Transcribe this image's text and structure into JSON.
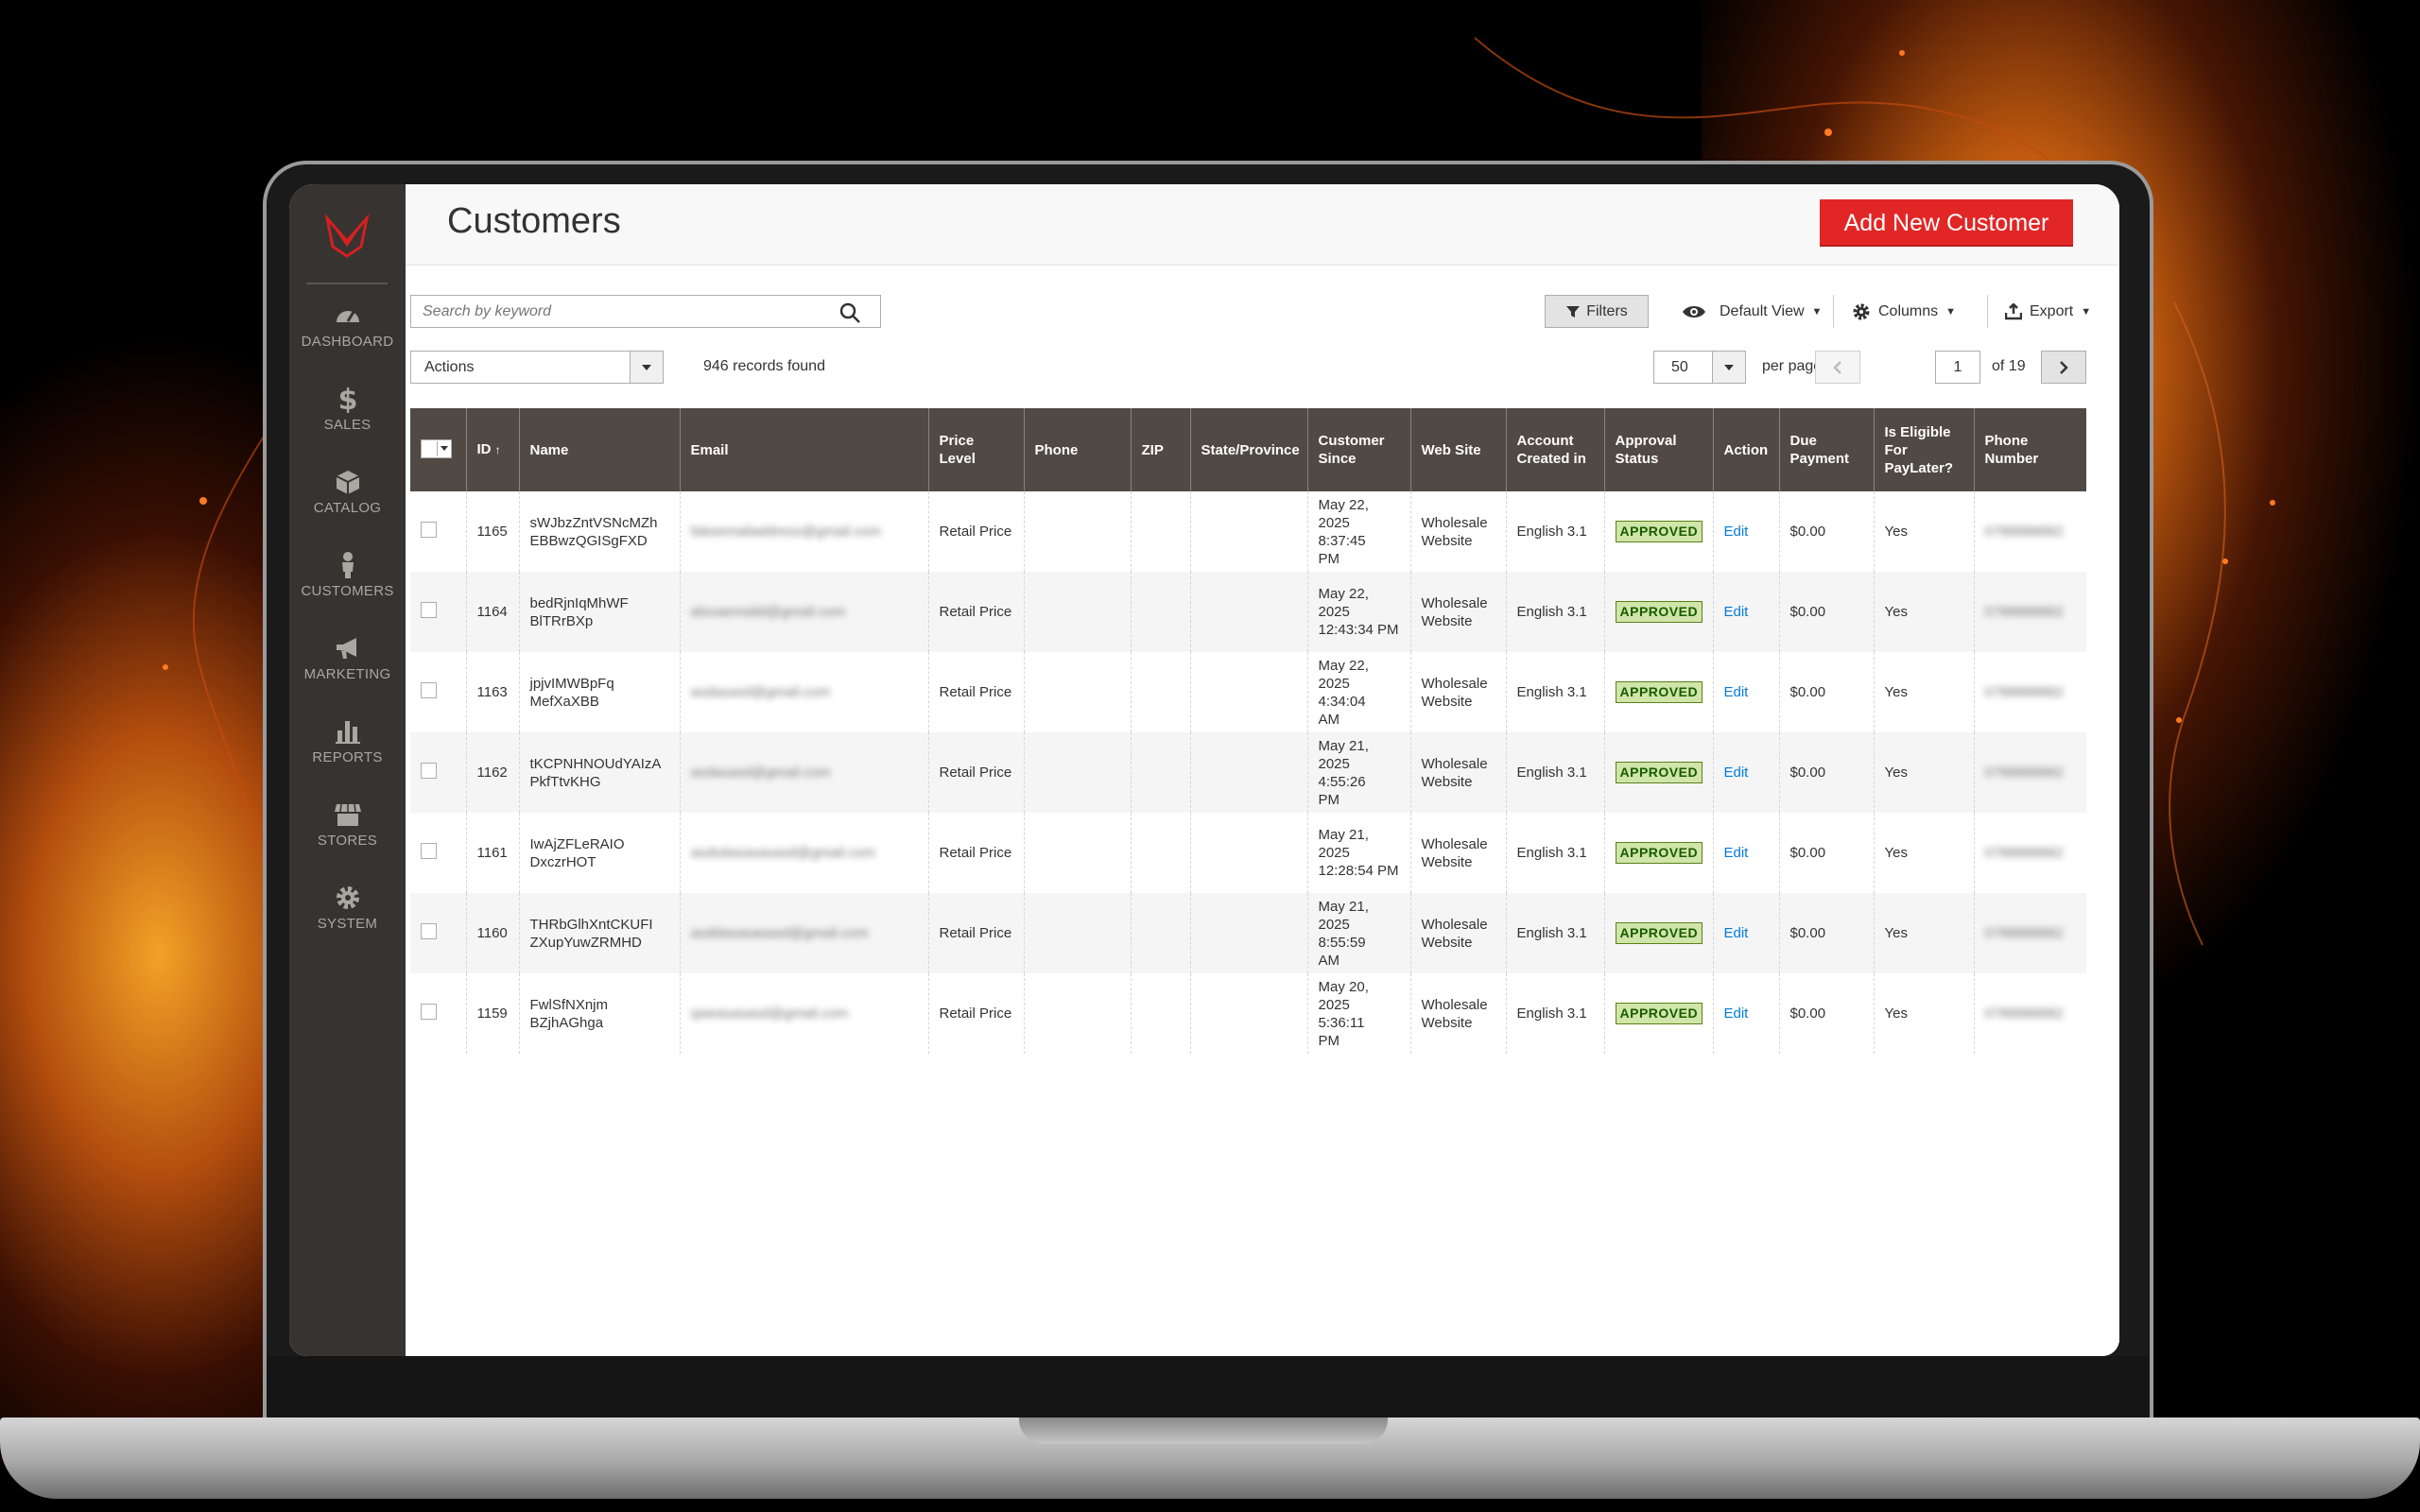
{
  "app": {
    "title": "Customers",
    "accent_color": "#e22626",
    "sidebar_bg": "#373330"
  },
  "sidebar": {
    "items": [
      {
        "label": "DASHBOARD",
        "icon": "dashboard-icon"
      },
      {
        "label": "SALES",
        "icon": "dollar-icon"
      },
      {
        "label": "CATALOG",
        "icon": "box-icon"
      },
      {
        "label": "CUSTOMERS",
        "icon": "person-icon"
      },
      {
        "label": "MARKETING",
        "icon": "megaphone-icon"
      },
      {
        "label": "REPORTS",
        "icon": "bar-chart-icon"
      },
      {
        "label": "STORES",
        "icon": "storefront-icon"
      },
      {
        "label": "SYSTEM",
        "icon": "gear-icon"
      }
    ]
  },
  "header": {
    "title": "Customers",
    "add_button": "Add New Customer"
  },
  "toolbar": {
    "search_placeholder": "Search by keyword",
    "filters": "Filters",
    "default_view": "Default View",
    "columns": "Columns",
    "export": "Export",
    "actions": "Actions",
    "records_found": "946 records found",
    "per_page_value": "50",
    "per_page_label": "per page",
    "current_page": "1",
    "total_pages": "of 19"
  },
  "grid": {
    "columns": [
      "ID",
      "Name",
      "Email",
      "Price Level",
      "Phone",
      "ZIP",
      "State/Province",
      "Customer Since",
      "Web Site",
      "Account Created in",
      "Approval Status",
      "Action",
      "Due Payment",
      "Is Eligible For PayLater?",
      "Phone Number"
    ],
    "sort_indicator": "↑",
    "rows": [
      {
        "id": "1165",
        "name1": "sWJbzZntVSNcMZh",
        "name2": "EBBwzQGISgFXD",
        "email": "fakeemailaddress@gmail.com",
        "price_level": "Retail Price",
        "since1": "May 22,",
        "since2": "2025 8:37:45",
        "since3": "PM",
        "website1": "Wholesale",
        "website2": "Website",
        "created": "English 3.1",
        "status": "APPROVED",
        "action": "Edit",
        "due": "$0.00",
        "eligible": "Yes",
        "phone": "0788888882"
      },
      {
        "id": "1164",
        "name1": "bedRjnIqMhWF",
        "name2": "BlTRrBXp",
        "email": "alsoaemaild@gmail.com",
        "price_level": "Retail Price",
        "since1": "May 22,",
        "since2": "2025",
        "since3": "12:43:34 PM",
        "website1": "Wholesale",
        "website2": "Website",
        "created": "English 3.1",
        "status": "APPROVED",
        "action": "Edit",
        "due": "$0.00",
        "eligible": "Yes",
        "phone": "0788888882"
      },
      {
        "id": "1163",
        "name1": "jpjvIMWBpFq",
        "name2": "MefXaXBB",
        "email": "asdasasd@gmail.com",
        "price_level": "Retail Price",
        "since1": "May 22,",
        "since2": "2025 4:34:04",
        "since3": "AM",
        "website1": "Wholesale",
        "website2": "Website",
        "created": "English 3.1",
        "status": "APPROVED",
        "action": "Edit",
        "due": "$0.00",
        "eligible": "Yes",
        "phone": "0788888882"
      },
      {
        "id": "1162",
        "name1": "tKCPNHNOUdYAIzA",
        "name2": "PkfTtvKHG",
        "email": "asdasasd@gmail.com",
        "price_level": "Retail Price",
        "since1": "May 21,",
        "since2": "2025 4:55:26",
        "since3": "PM",
        "website1": "Wholesale",
        "website2": "Website",
        "created": "English 3.1",
        "status": "APPROVED",
        "action": "Edit",
        "due": "$0.00",
        "eligible": "Yes",
        "phone": "0788888882"
      },
      {
        "id": "1161",
        "name1": "IwAjZFLeRAIO",
        "name2": "DxczrHOT",
        "email": "asdsdasasasasd@gmail.com",
        "price_level": "Retail Price",
        "since1": "May 21,",
        "since2": "2025",
        "since3": "12:28:54 PM",
        "website1": "Wholesale",
        "website2": "Website",
        "created": "English 3.1",
        "status": "APPROVED",
        "action": "Edit",
        "due": "$0.00",
        "eligible": "Yes",
        "phone": "0788888882"
      },
      {
        "id": "1160",
        "name1": "THRbGlhXntCKUFI",
        "name2": "ZXupYuwZRMHD",
        "email": "asddasasasasd@gmail.com",
        "price_level": "Retail Price",
        "since1": "May 21,",
        "since2": "2025 8:55:59",
        "since3": "AM",
        "website1": "Wholesale",
        "website2": "Website",
        "created": "English 3.1",
        "status": "APPROVED",
        "action": "Edit",
        "due": "$0.00",
        "eligible": "Yes",
        "phone": "0788888882"
      },
      {
        "id": "1159",
        "name1": "FwlSfNXnjm",
        "name2": "BZjhAGhga",
        "email": "qweasasasd@gmail.com",
        "price_level": "Retail Price",
        "since1": "May 20,",
        "since2": "2025 5:36:11",
        "since3": "PM",
        "website1": "Wholesale",
        "website2": "Website",
        "created": "English 3.1",
        "status": "APPROVED",
        "action": "Edit",
        "due": "$0.00",
        "eligible": "Yes",
        "phone": "0788888882"
      }
    ]
  }
}
